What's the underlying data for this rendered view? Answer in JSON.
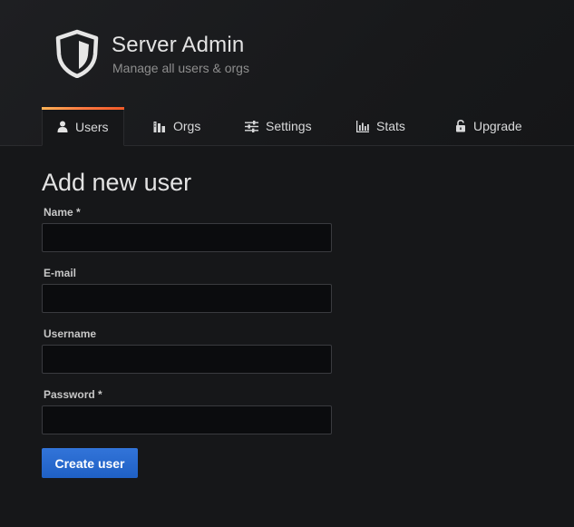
{
  "header": {
    "title": "Server Admin",
    "subtitle": "Manage all users & orgs",
    "logo_icon": "shield-icon"
  },
  "tabs": [
    {
      "label": "Users",
      "icon": "user-icon",
      "active": true
    },
    {
      "label": "Orgs",
      "icon": "building-icon",
      "active": false
    },
    {
      "label": "Settings",
      "icon": "sliders-icon",
      "active": false
    },
    {
      "label": "Stats",
      "icon": "bar-chart-icon",
      "active": false
    },
    {
      "label": "Upgrade",
      "icon": "unlock-icon",
      "active": false
    }
  ],
  "form": {
    "title": "Add new user",
    "fields": [
      {
        "label": "Name *",
        "value": "",
        "placeholder": ""
      },
      {
        "label": "E-mail",
        "value": "",
        "placeholder": ""
      },
      {
        "label": "Username",
        "value": "",
        "placeholder": ""
      },
      {
        "label": "Password *",
        "value": "",
        "placeholder": ""
      }
    ],
    "submit_label": "Create user"
  },
  "colors": {
    "background": "#161719",
    "primary_button": "#3274d9",
    "tab_accent": "#ff7941"
  }
}
